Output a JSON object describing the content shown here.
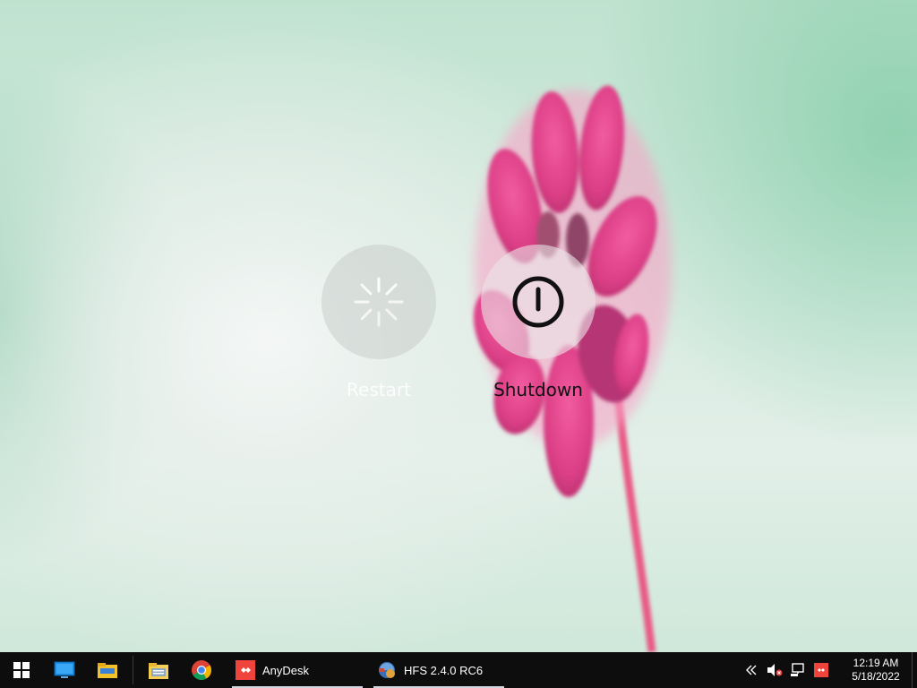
{
  "power_menu": {
    "restart_label": "Restart",
    "shutdown_label": "Shutdown",
    "restart_icon": "loading-spinner-icon",
    "shutdown_icon": "power-icon"
  },
  "taskbar": {
    "start_icon": "windows-logo-icon",
    "pinned": [
      {
        "name": "desktop-icon"
      },
      {
        "name": "file-explorer-icon"
      },
      {
        "name": "folder-icon"
      },
      {
        "name": "chrome-icon"
      }
    ],
    "apps": [
      {
        "label": "AnyDesk",
        "icon": "anydesk-icon"
      },
      {
        "label": "HFS 2.4.0 RC6",
        "icon": "hfs-icon"
      }
    ],
    "tray": {
      "overflow_icon": "chevron-left-icon",
      "volume_icon": "volume-muted-icon",
      "network_icon": "network-icon",
      "anydesk_icon": "anydesk-tray-icon"
    },
    "clock": {
      "time": "12:19 AM",
      "date": "5/18/2022"
    }
  },
  "colors": {
    "taskbar_bg": "#0d0d0d",
    "anydesk_red": "#ef443b",
    "flower_pink": "#e0468a"
  }
}
